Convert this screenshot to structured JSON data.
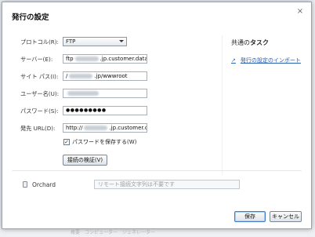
{
  "dialog": {
    "title": "発行の設定",
    "close_glyph": "×"
  },
  "form": {
    "protocol_label": "プロトコル(R):",
    "protocol_value": "FTP",
    "server_label": "サーバー(E):",
    "server_value_prefix": "ftp",
    "server_value_suffix": ".jp.customer.datav",
    "site_path_label": "サイト パス(I):",
    "site_path_value_prefix": "/",
    "site_path_value_suffix": ".jp/wwwroot",
    "username_label": "ユーザー名(U):",
    "password_label": "パスワード(S):",
    "password_value": "●●●●●●●●●",
    "dest_url_label": "発先 URL(D):",
    "dest_url_value_prefix": "http://",
    "dest_url_value_suffix": ".jp.customer.da",
    "save_password_checked": "✓",
    "save_password_label": "パスワードを保存する(W)",
    "verify_button": "接続の検証(V)"
  },
  "sidebar": {
    "title_prefix": "共通の",
    "title_bold": "タスク",
    "import_link": "発行の設定のインポート",
    "import_icon": "↗"
  },
  "orchard": {
    "label": "Orchard",
    "remote_placeholder": "リモート接続文字列は不要です"
  },
  "footer": {
    "save_button": "保存",
    "cancel_button": "キャンセル"
  },
  "background": {
    "bottom_text": "概要　コンピューター　ジェネレーター"
  }
}
